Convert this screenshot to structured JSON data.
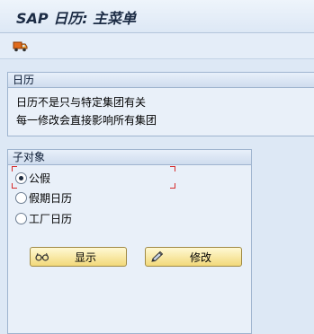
{
  "window": {
    "title": "SAP 日历: 主菜单"
  },
  "toolbar": {
    "icons": [
      "truck-icon"
    ]
  },
  "calendar_group": {
    "header": "日历",
    "lines": [
      "日历不是只与特定集团有关",
      "每一修改会直接影响所有集团"
    ]
  },
  "subobject_group": {
    "header": "子对象",
    "options": [
      {
        "label": "公假",
        "selected": true
      },
      {
        "label": "假期日历",
        "selected": false
      },
      {
        "label": "工厂日历",
        "selected": false
      }
    ]
  },
  "buttons": {
    "display_label": "显示",
    "display_icon": "glasses-icon",
    "change_label": "修改",
    "change_icon": "pencil-icon"
  },
  "colors": {
    "background": "#dde8f5",
    "button_fill": "#f2d97a",
    "focus": "#d62b2b"
  }
}
